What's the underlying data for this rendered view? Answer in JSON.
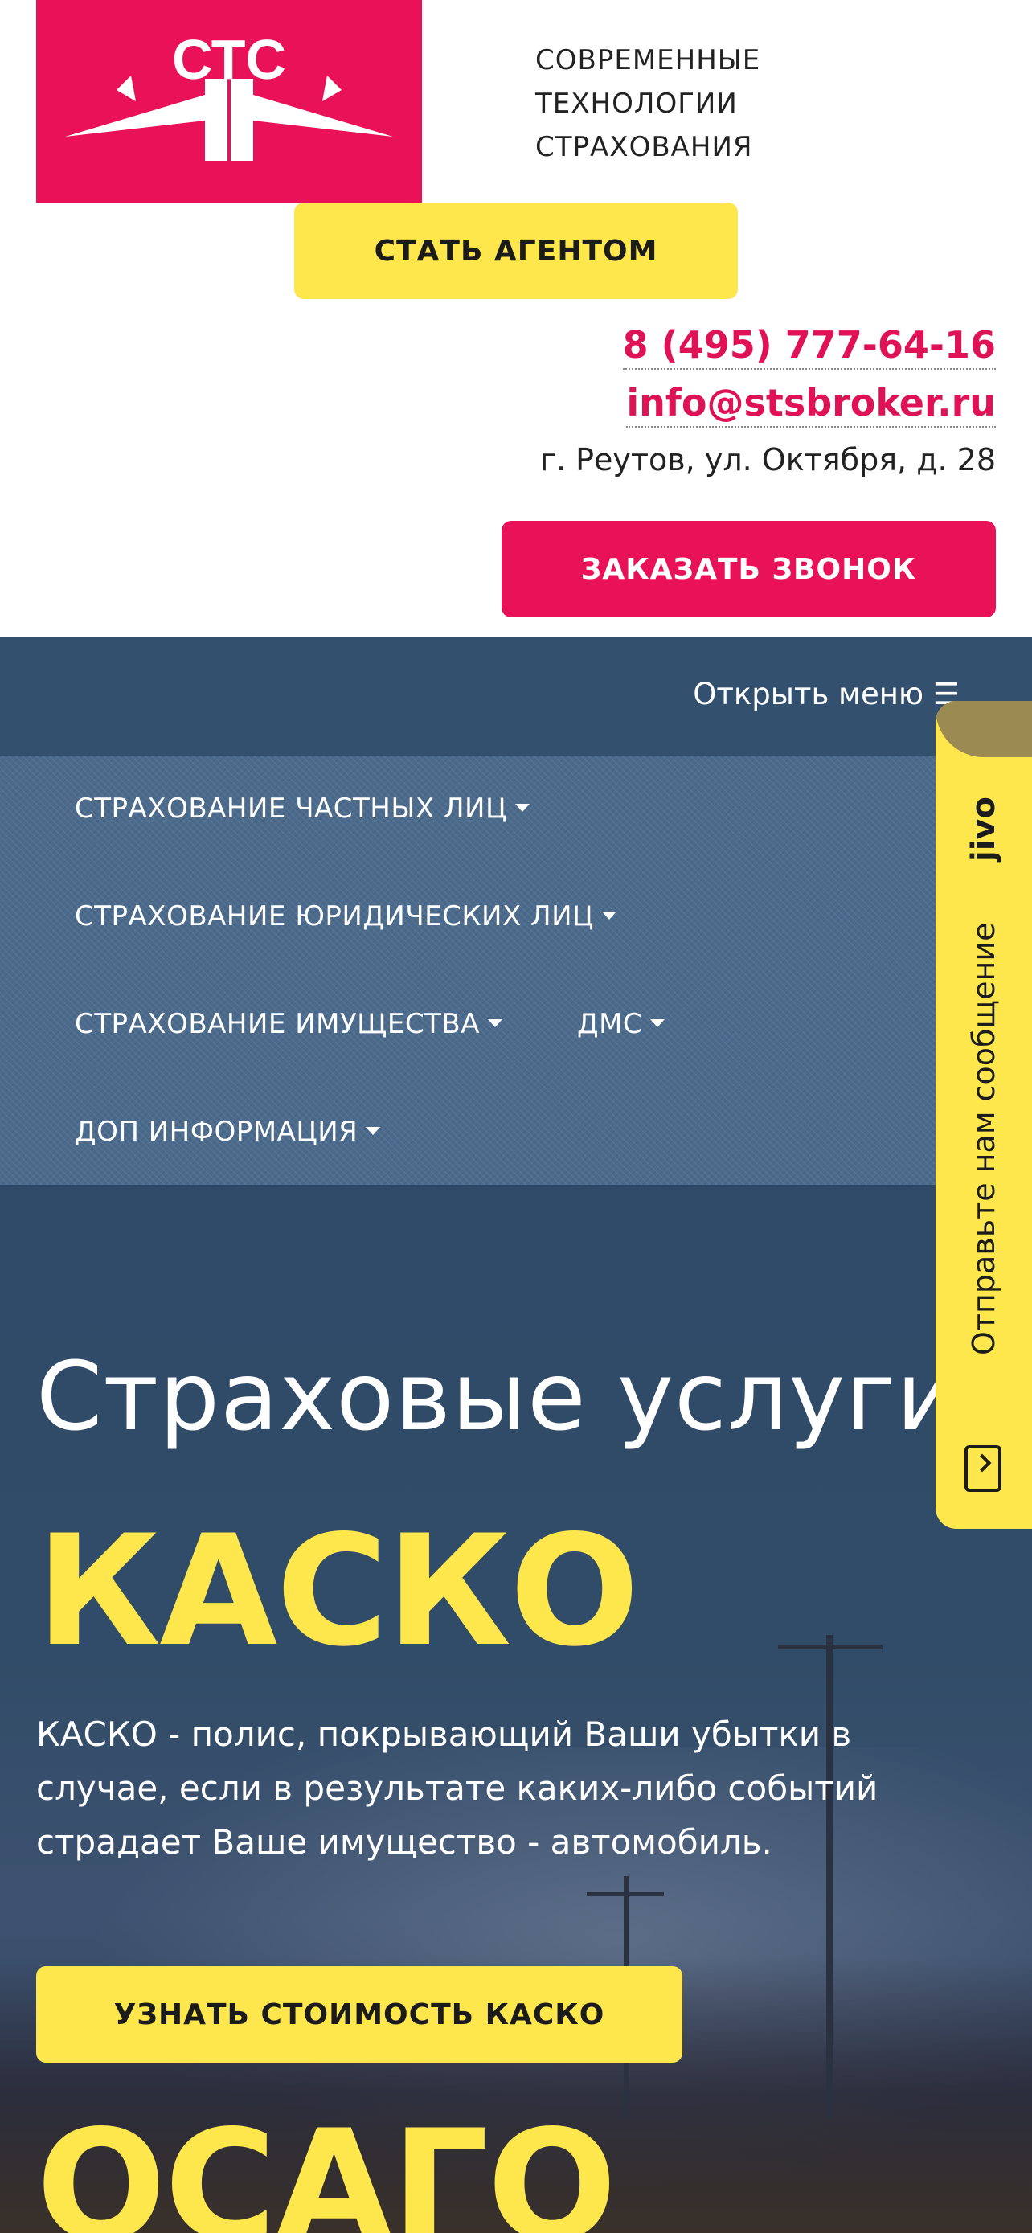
{
  "header": {
    "logo_text": "СТС",
    "tagline": [
      "СОВРЕМЕННЫЕ",
      "ТЕХНОЛОГИИ",
      "СТРАХОВАНИЯ"
    ],
    "become_agent_label": "СТАТЬ АГЕНТОМ",
    "phone": "8 (495) 777-64-16",
    "email": "info@stsbroker.ru",
    "address": "г. Реутов, ул. Октября, д. 28",
    "order_call_label": "ЗАКАЗАТЬ ЗВОНОК"
  },
  "nav": {
    "open_menu_label": "Открыть меню ☰",
    "items": [
      {
        "label": "СТРАХОВАНИЕ ЧАСТНЫХ ЛИЦ"
      },
      {
        "label": "СТРАХОВАНИЕ ЮРИДИЧЕСКИХ ЛИЦ"
      },
      {
        "label": "СТРАХОВАНИЕ ИМУЩЕСТВА"
      },
      {
        "label": "ДМС"
      },
      {
        "label": "ДОП ИНФОРМАЦИЯ"
      }
    ]
  },
  "hero": {
    "title": "Страховые услуги",
    "product_1_title": "КАСКО",
    "product_1_desc": "КАСКО - полис, покрывающий Ваши убытки в случае, если в результате каких-либо событий страдает Ваше имущество - автомобиль.",
    "product_1_button": "УЗНАТЬ СТОИМОСТЬ КАСКО",
    "product_2_title": "ОСАГО"
  },
  "jivo": {
    "brand": "jivo",
    "text": "Отправьте нам сообщение"
  },
  "colors": {
    "brand_pink": "#e91157",
    "accent_yellow": "#fde74c",
    "nav_blue": "#34506f"
  }
}
